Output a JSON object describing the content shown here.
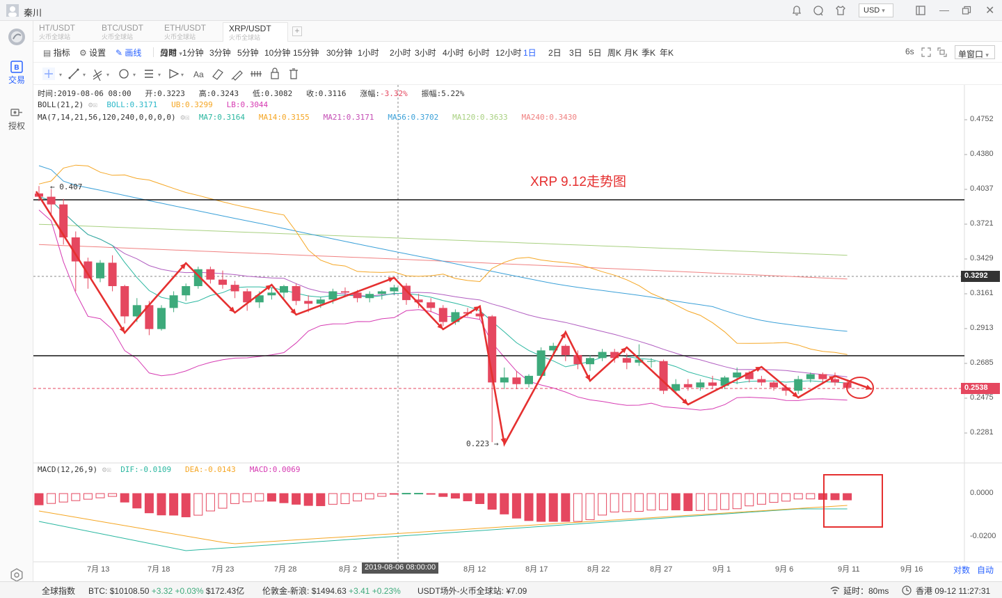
{
  "titlebar": {
    "user": "秦川",
    "currency": "USD"
  },
  "sidebar": {
    "trade": "交易",
    "auth": "授权"
  },
  "tabs": [
    {
      "pair": "HT/USDT",
      "site": "火币全球站",
      "active": false
    },
    {
      "pair": "BTC/USDT",
      "site": "火币全球站",
      "active": false
    },
    {
      "pair": "ETH/USDT",
      "site": "火币全球站",
      "active": false
    },
    {
      "pair": "XRP/USDT",
      "site": "火币全球站",
      "active": true
    }
  ],
  "toolbar": {
    "indicator": "指标",
    "settings": "设置",
    "draw": "画线",
    "period": "周期"
  },
  "periods": [
    "分时",
    "1分钟",
    "3分钟",
    "5分钟",
    "10分钟",
    "15分钟",
    "30分钟",
    "1小时",
    "2小时",
    "3小时",
    "4小时",
    "6小时",
    "12小时",
    "1日",
    "2日",
    "3日",
    "5日",
    "周K",
    "月K",
    "季K",
    "年K"
  ],
  "selected_period": "1日",
  "refresh": "6s",
  "window_mode": "单窗口",
  "info": {
    "time": "时间:2019-08-06 08:00",
    "open": "开:0.3223",
    "high": "高:0.3243",
    "low": "低:0.3082",
    "close": "收:0.3116",
    "change": "涨幅:",
    "change_val": "-3.32%",
    "amplitude": "振幅:5.22%"
  },
  "boll": {
    "label": "BOLL(21,2)",
    "boll": "BOLL:0.3171",
    "ub": "UB:0.3299",
    "lb": "LB:0.3044"
  },
  "ma": {
    "label": "MA(7,14,21,56,120,240,0,0,0,0)",
    "items": [
      "MA7:0.3164",
      "MA14:0.3155",
      "MA21:0.3171",
      "MA56:0.3702",
      "MA120:0.3633",
      "MA240:0.3430"
    ]
  },
  "macd": {
    "label": "MACD(12,26,9)",
    "dif": "DIF:-0.0109",
    "dea": "DEA:-0.0143",
    "macd": "MACD:0.0069"
  },
  "annotation": "XRP  9.12走势图",
  "price_axis": [
    "0.4752",
    "0.4380",
    "0.4037",
    "0.3721",
    "0.3429",
    "0.3161",
    "0.2913",
    "0.2685",
    "0.2475",
    "0.2281"
  ],
  "price_tags": {
    "crosshair": "0.3292",
    "current": "0.2538"
  },
  "macd_axis": [
    "0.0000",
    "-0.0200"
  ],
  "markers": {
    "high": "← 0.407",
    "low": "0.223 →"
  },
  "date_axis": [
    "7月 13",
    "7月 18",
    "7月 23",
    "7月 28",
    "8月 2",
    "8月 12",
    "8月 17",
    "8月 22",
    "8月 27",
    "9月 1",
    "9月 6",
    "9月 11",
    "9月 16"
  ],
  "crosshair_date": "2019-08-06 08:00:00",
  "axis_modes": {
    "log": "对数",
    "auto": "自动"
  },
  "statusbar": {
    "index": "全球指数",
    "btc_label": "BTC:",
    "btc_price": "$10108.50",
    "btc_change": "+3.32 +0.03%",
    "btc_cap": "$172.43亿",
    "gold_label": "伦敦金-新浪:",
    "gold_price": "$1494.63",
    "gold_change": "+3.41 +0.23%",
    "usdt": "USDT场外-火币全球站: ¥7.09",
    "latency": "延时：80ms",
    "server": "香港 09-12 11:27:31"
  },
  "colors": {
    "up": "#3daa7b",
    "down": "#e5475f",
    "accent": "#2962ff",
    "annotation": "#e53030"
  },
  "chart_data": {
    "type": "candlestick",
    "dates_start": "2019-07-10",
    "ohlc": [
      [
        0.4,
        0.407,
        0.393,
        0.397
      ],
      [
        0.397,
        0.404,
        0.38,
        0.39
      ],
      [
        0.39,
        0.395,
        0.355,
        0.361
      ],
      [
        0.361,
        0.366,
        0.318,
        0.341
      ],
      [
        0.341,
        0.344,
        0.32,
        0.328
      ],
      [
        0.328,
        0.342,
        0.325,
        0.34
      ],
      [
        0.34,
        0.346,
        0.318,
        0.322
      ],
      [
        0.322,
        0.323,
        0.295,
        0.3
      ],
      [
        0.3,
        0.313,
        0.296,
        0.308
      ],
      [
        0.308,
        0.311,
        0.287,
        0.291
      ],
      [
        0.291,
        0.308,
        0.29,
        0.306
      ],
      [
        0.306,
        0.318,
        0.303,
        0.315
      ],
      [
        0.315,
        0.324,
        0.311,
        0.322
      ],
      [
        0.322,
        0.337,
        0.32,
        0.335
      ],
      [
        0.335,
        0.337,
        0.324,
        0.327
      ],
      [
        0.327,
        0.334,
        0.32,
        0.323
      ],
      [
        0.323,
        0.326,
        0.313,
        0.318
      ],
      [
        0.318,
        0.32,
        0.304,
        0.31
      ],
      [
        0.31,
        0.318,
        0.306,
        0.315
      ],
      [
        0.315,
        0.321,
        0.312,
        0.317
      ],
      [
        0.317,
        0.323,
        0.313,
        0.322
      ],
      [
        0.322,
        0.324,
        0.308,
        0.311
      ],
      [
        0.311,
        0.315,
        0.303,
        0.309
      ],
      [
        0.309,
        0.314,
        0.306,
        0.312
      ],
      [
        0.312,
        0.32,
        0.309,
        0.318
      ],
      [
        0.318,
        0.321,
        0.314,
        0.317
      ],
      [
        0.317,
        0.319,
        0.31,
        0.313
      ],
      [
        0.313,
        0.318,
        0.31,
        0.316
      ],
      [
        0.316,
        0.319,
        0.312,
        0.318
      ],
      [
        0.318,
        0.323,
        0.315,
        0.321
      ],
      [
        0.3223,
        0.3243,
        0.3082,
        0.3116
      ],
      [
        0.312,
        0.316,
        0.306,
        0.31
      ],
      [
        0.31,
        0.313,
        0.303,
        0.306
      ],
      [
        0.306,
        0.308,
        0.293,
        0.296
      ],
      [
        0.296,
        0.305,
        0.294,
        0.303
      ],
      [
        0.303,
        0.306,
        0.3,
        0.302
      ],
      [
        0.302,
        0.304,
        0.298,
        0.3
      ],
      [
        0.3,
        0.301,
        0.223,
        0.257
      ],
      [
        0.257,
        0.266,
        0.253,
        0.26
      ],
      [
        0.26,
        0.264,
        0.253,
        0.256
      ],
      [
        0.256,
        0.262,
        0.254,
        0.261
      ],
      [
        0.261,
        0.279,
        0.259,
        0.277
      ],
      [
        0.277,
        0.282,
        0.274,
        0.28
      ],
      [
        0.28,
        0.281,
        0.27,
        0.274
      ],
      [
        0.274,
        0.277,
        0.265,
        0.268
      ],
      [
        0.268,
        0.274,
        0.264,
        0.272
      ],
      [
        0.272,
        0.278,
        0.27,
        0.276
      ],
      [
        0.276,
        0.278,
        0.269,
        0.272
      ],
      [
        0.272,
        0.275,
        0.265,
        0.269
      ],
      [
        0.269,
        0.281,
        0.267,
        0.271
      ],
      [
        0.27,
        0.272,
        0.266,
        0.27
      ],
      [
        0.27,
        0.271,
        0.25,
        0.252
      ],
      [
        0.252,
        0.259,
        0.25,
        0.256
      ],
      [
        0.256,
        0.259,
        0.252,
        0.254
      ],
      [
        0.254,
        0.259,
        0.252,
        0.257
      ],
      [
        0.257,
        0.261,
        0.253,
        0.255
      ],
      [
        0.255,
        0.261,
        0.253,
        0.26
      ],
      [
        0.26,
        0.266,
        0.256,
        0.263
      ],
      [
        0.263,
        0.264,
        0.257,
        0.259
      ],
      [
        0.259,
        0.261,
        0.255,
        0.257
      ],
      [
        0.257,
        0.258,
        0.252,
        0.254
      ],
      [
        0.254,
        0.256,
        0.249,
        0.252
      ],
      [
        0.252,
        0.261,
        0.25,
        0.259
      ],
      [
        0.259,
        0.263,
        0.257,
        0.262
      ],
      [
        0.262,
        0.263,
        0.256,
        0.259
      ],
      [
        0.259,
        0.263,
        0.255,
        0.257
      ],
      [
        0.257,
        0.258,
        0.252,
        0.2538
      ]
    ]
  }
}
